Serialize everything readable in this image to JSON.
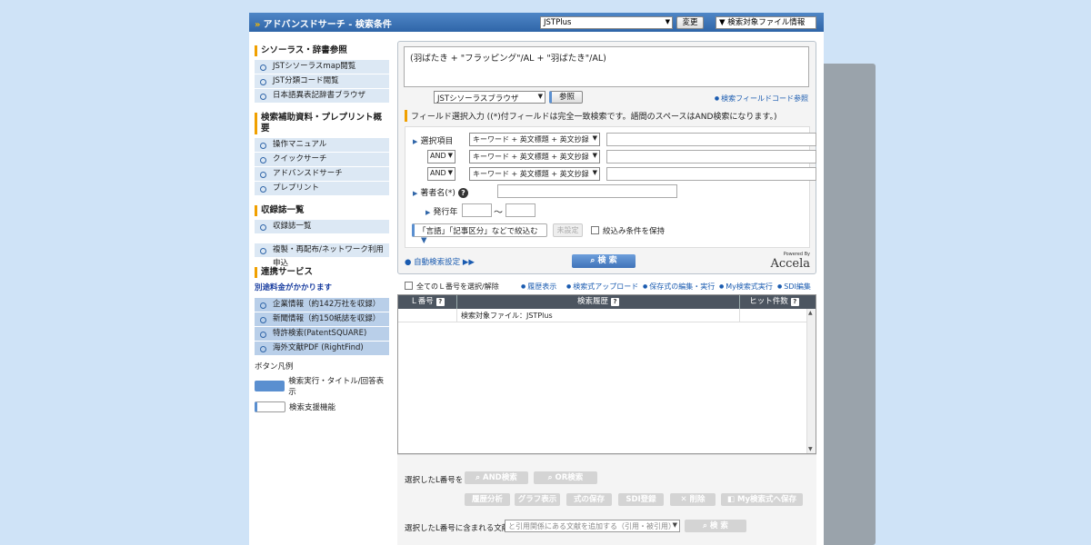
{
  "header": {
    "title": "アドバンスドサーチ - 検索条件",
    "db_selected": "JSTPlus",
    "change_label": "変更",
    "file_info_label": "検索対象ファイル情報"
  },
  "sidebar": {
    "sections": [
      {
        "title": "シソーラス・辞書参照",
        "items": [
          "JSTシソーラスmap閲覧",
          "JST分類コード閲覧",
          "日本語異表記辞書ブラウザ"
        ]
      },
      {
        "title": "検索補助資料・プレプリント概要",
        "items": [
          "操作マニュアル",
          "クイックサーチ",
          "アドバンスドサーチ",
          "プレプリント"
        ]
      },
      {
        "title": "収録誌一覧",
        "items": [
          "収録誌一覧"
        ]
      }
    ],
    "standalone_item": "複製・再配布/ネットワーク利用申込",
    "linked": {
      "title": "連携サービス",
      "note": "別途料金がかかります",
      "items": [
        "企業情報（約142万社を収録）",
        "新聞情報（約150紙誌を収録）",
        "特許検索(PatentSQUARE)",
        "海外文献PDF (RightFind)"
      ]
    },
    "legend": {
      "title": "ボタン凡例",
      "primary": "検索実行・タイトル/回答表示",
      "support": "検索支援機能"
    }
  },
  "search": {
    "query": "(羽ばたき + \"フラッピング\"/AL + \"羽ばたき\"/AL)",
    "thesaurus_select": "JSTシソーラスブラウザ",
    "ref_button": "参照",
    "field_code_ref": "検索フィールドコード参照",
    "field_section_title": "フィールド選択入力 ((*)付フィールドは完全一致検索です。語間のスペースはAND検索になります。)",
    "field_label": "選択項目",
    "rows": [
      {
        "op": "",
        "field": "キーワード + 英文標題 + 英文抄録"
      },
      {
        "op": "AND",
        "field": "キーワード + 英文標題 + 英文抄録"
      },
      {
        "op": "AND",
        "field": "キーワード + 英文標題 + 英文抄録"
      }
    ],
    "author_label": "著者名(*)",
    "year_label": "発行年",
    "tilde": "〜",
    "narrow_label": "「言語」「記事区分」などで絞込む",
    "unset_label": "未設定",
    "keep_label": "絞込み条件を保持",
    "auto_search": "自動検索設定",
    "search_button": "検 索",
    "powered_by": "Powered By",
    "powered_brand": "Accela"
  },
  "history": {
    "select_all": "全てのＬ番号を選択/解除",
    "links": [
      "履歴表示",
      "検索式アップロード",
      "保存式の編集・実行",
      "My検索式実行",
      "SDI編集"
    ],
    "columns": [
      "Ｌ番号",
      "検索履歴",
      "ヒット件数"
    ],
    "rows": [
      {
        "l": "",
        "query": "検索対象ファイル：JSTPlus",
        "hits": ""
      }
    ]
  },
  "bottom": {
    "selected_label": "選択したL番号を",
    "and_search": "AND検索",
    "or_search": "OR検索",
    "actions": [
      "履歴分析",
      "グラフ表示",
      "式の保存",
      "SDI登録",
      "削除",
      "My検索式へ保存"
    ],
    "contained_label": "選択したL番号に含まれる文献",
    "related_placeholder": "と引用関係にある文献を追加する（引用・被引用）",
    "search_button": "検 索"
  }
}
